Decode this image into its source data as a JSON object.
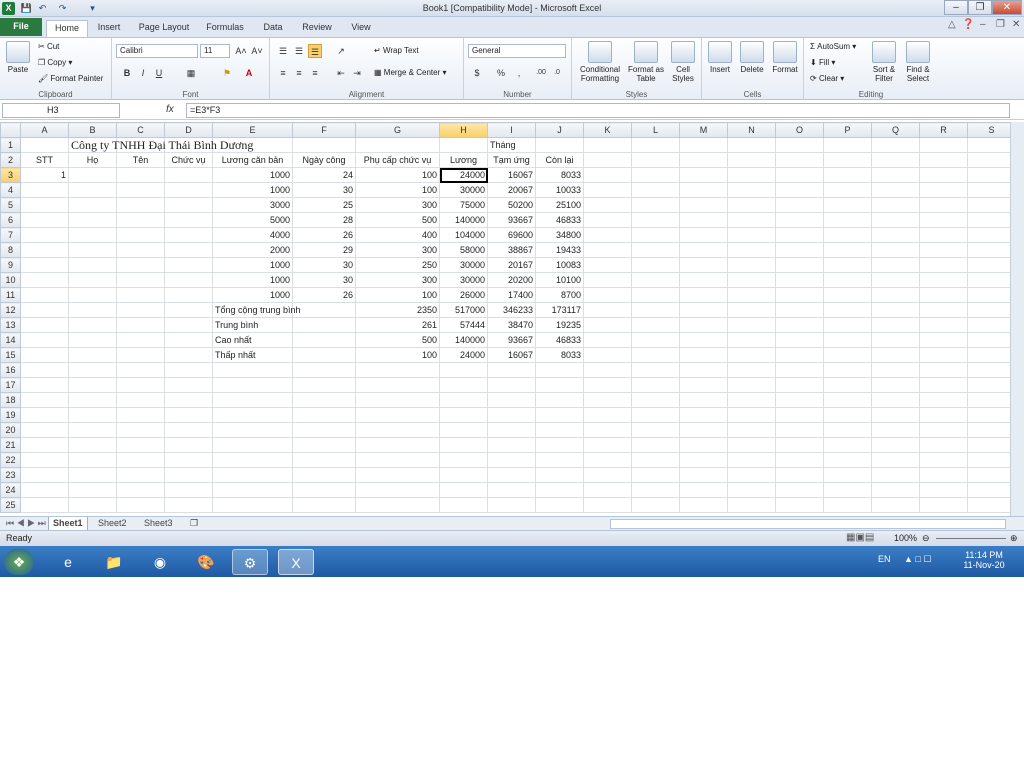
{
  "window": {
    "title": "Book1  [Compatibility Mode]  -  Microsoft Excel",
    "app_icon": "X"
  },
  "ribbon_tabs": [
    "File",
    "Home",
    "Insert",
    "Page Layout",
    "Formulas",
    "Data",
    "Review",
    "View"
  ],
  "ribbon": {
    "clipboard": {
      "paste": "Paste",
      "cut": "Cut",
      "copy": "Copy",
      "format_painter": "Format Painter",
      "label": "Clipboard"
    },
    "font": {
      "family": "Calibri",
      "size": "11",
      "label": "Font",
      "bold": "B",
      "italic": "I",
      "underline": "U"
    },
    "alignment": {
      "wrap_text": "Wrap Text",
      "merge_center": "Merge & Center",
      "label": "Alignment"
    },
    "number": {
      "format": "General",
      "currency": "$",
      "percent": "%",
      "comma": ",",
      "label": "Number"
    },
    "styles": {
      "conditional": "Conditional Formatting",
      "format_table": "Format as Table",
      "cell_styles": "Cell Styles",
      "label": "Styles"
    },
    "cells": {
      "insert": "Insert",
      "delete": "Delete",
      "format": "Format",
      "label": "Cells"
    },
    "editing": {
      "autosum": "AutoSum",
      "fill": "Fill",
      "clear": "Clear",
      "sort_filter": "Sort & Filter",
      "find_select": "Find & Select",
      "label": "Editing"
    }
  },
  "formula_bar": {
    "name_box": "H3",
    "fx": "fx",
    "formula": "=E3*F3"
  },
  "columns": [
    "A",
    "B",
    "C",
    "D",
    "E",
    "F",
    "G",
    "H",
    "I",
    "J",
    "K",
    "L",
    "M",
    "N",
    "O",
    "P",
    "Q",
    "R",
    "S"
  ],
  "rows": [
    [
      "",
      "Công ty TNHH Đại Thái Bình Dương",
      "",
      "",
      "",
      "",
      "",
      "",
      "Tháng",
      ""
    ],
    [
      "STT",
      "Họ",
      "Tên",
      "Chức vụ",
      "Lương căn bản",
      "Ngày công",
      "Phụ cấp chức vụ",
      "Lương",
      "Tạm ứng",
      "Còn lại"
    ],
    [
      "1",
      "",
      "",
      "",
      "1000",
      "24",
      "100",
      "24000",
      "16067",
      "8033"
    ],
    [
      "",
      "",
      "",
      "",
      "1000",
      "30",
      "100",
      "30000",
      "20067",
      "10033"
    ],
    [
      "",
      "",
      "",
      "",
      "3000",
      "25",
      "300",
      "75000",
      "50200",
      "25100"
    ],
    [
      "",
      "",
      "",
      "",
      "5000",
      "28",
      "500",
      "140000",
      "93667",
      "46833"
    ],
    [
      "",
      "",
      "",
      "",
      "4000",
      "26",
      "400",
      "104000",
      "69600",
      "34800"
    ],
    [
      "",
      "",
      "",
      "",
      "2000",
      "29",
      "300",
      "58000",
      "38867",
      "19433"
    ],
    [
      "",
      "",
      "",
      "",
      "1000",
      "30",
      "250",
      "30000",
      "20167",
      "10083"
    ],
    [
      "",
      "",
      "",
      "",
      "1000",
      "30",
      "300",
      "30000",
      "20200",
      "10100"
    ],
    [
      "",
      "",
      "",
      "",
      "1000",
      "26",
      "100",
      "26000",
      "17400",
      "8700"
    ],
    [
      "",
      "",
      "",
      "",
      "Tổng cộng trung bình",
      "",
      "2350",
      "517000",
      "346233",
      "173117"
    ],
    [
      "",
      "",
      "",
      "",
      "Trung bình",
      "",
      "261",
      "57444",
      "38470",
      "19235"
    ],
    [
      "",
      "",
      "",
      "",
      "Cao nhất",
      "",
      "500",
      "140000",
      "93667",
      "46833"
    ],
    [
      "",
      "",
      "",
      "",
      "Thấp nhất",
      "",
      "100",
      "24000",
      "16067",
      "8033"
    ]
  ],
  "total_rows": 25,
  "active_cell": "H3",
  "sheets": [
    "Sheet1",
    "Sheet2",
    "Sheet3"
  ],
  "status": {
    "ready": "Ready",
    "zoom": "100%"
  },
  "taskbar": {
    "language": "EN",
    "time": "11:14 PM",
    "date": "11-Nov-20"
  }
}
